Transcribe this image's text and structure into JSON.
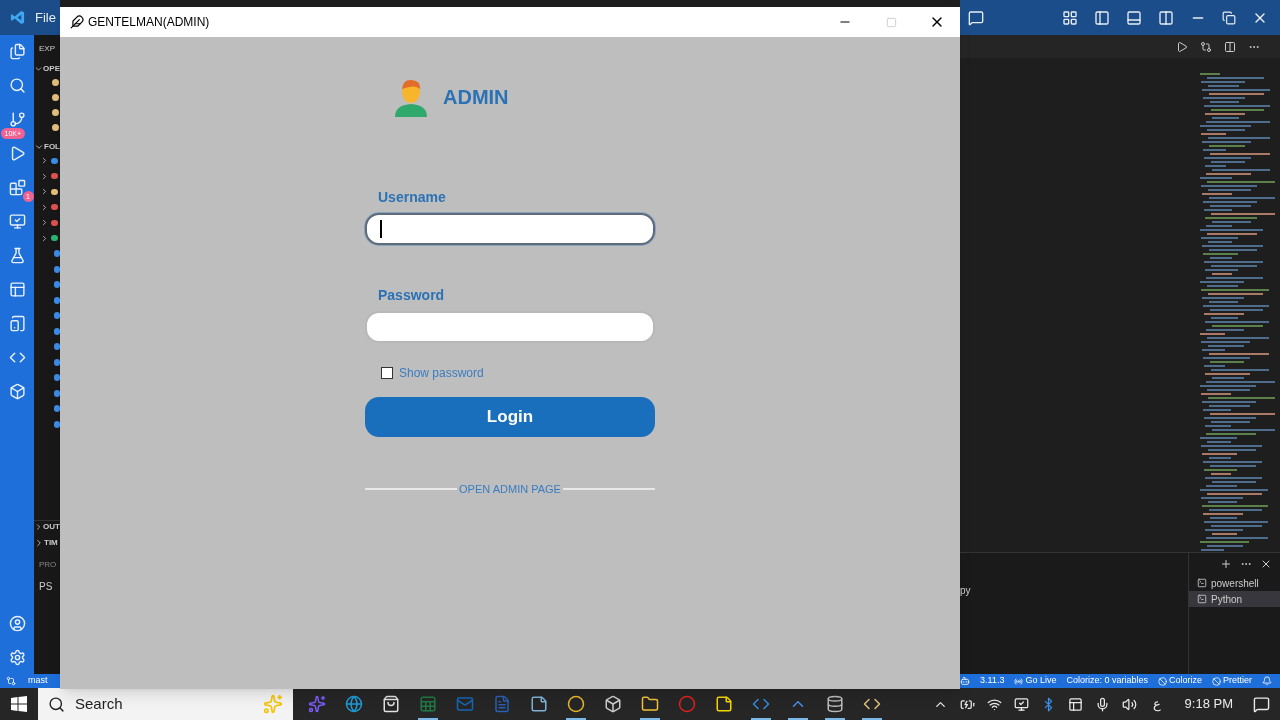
{
  "vscode": {
    "menu": "File",
    "badges": [
      "10K+",
      "1"
    ],
    "sidebar_top": [
      "EXP",
      "OPE",
      "FOL"
    ],
    "sidebar_bottom": [
      "OUT",
      "TIM",
      "PRO",
      "PS"
    ],
    "branch": "mast",
    "editor_fragment": "py",
    "terminals": [
      {
        "label": "powershell",
        "selected": false
      },
      {
        "label": "Python",
        "selected": true
      }
    ],
    "status_items": [
      {
        "kind": "plain",
        "text": "3.11.3"
      },
      {
        "kind": "live",
        "text": "Go Live"
      },
      {
        "kind": "plain",
        "text": "Colorize: 0 variables"
      },
      {
        "kind": "off",
        "text": "Colorize"
      },
      {
        "kind": "off",
        "text": "Prettier"
      }
    ]
  },
  "window": {
    "title": "GENTELMAN(ADMIN)"
  },
  "login": {
    "heading": "ADMIN",
    "fields": [
      {
        "label": "Username",
        "focused": true
      },
      {
        "label": "Password",
        "focused": false
      }
    ],
    "show_password": {
      "label": "Show password",
      "checked": false
    },
    "button": "Login",
    "link": "OPEN ADMIN PAGE"
  },
  "taskbar": {
    "search": "Search",
    "language": "ع",
    "clock": "9:18 PM"
  }
}
